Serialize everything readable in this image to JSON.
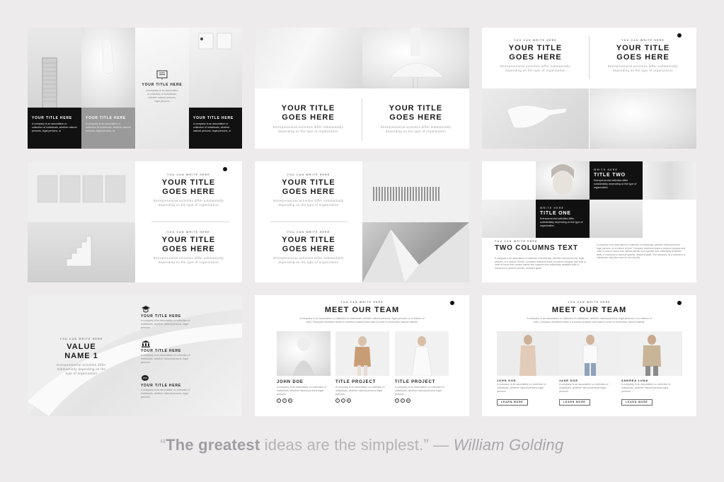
{
  "slides": {
    "s1": {
      "center_title": "YOUR TITLE HERE",
      "center_body": "A company is an association or collection of individuals, whether natural persons, legal persons",
      "box1_title": "YOUR TITLE HERE",
      "box1_body": "A company is an association or collection of individuals, whether natural persons, legal persons, or",
      "box2_title": "YOUR TITLE HERE",
      "box2_body": "A company is an association or collection of individuals, whether natural persons, legal persons, or",
      "box3_title": "YOUR TITLE HERE",
      "box3_body": "A company is an association or collection of individuals, whether natural persons, legal persons, or"
    },
    "s2": {
      "left_title": "YOUR TITLE\nGOES HERE",
      "left_sub": "Entrepreneurial activities differ substantially\ndepending on the type of organization",
      "right_title": "YOUR TITLE\nGOES HERE",
      "right_sub": "Entrepreneurial activities differ substantially\ndepending on the type of organization"
    },
    "s3": {
      "left_kicker": "YOU CAN WRITE HERE",
      "left_title": "YOUR TITLE\nGOES HERE",
      "left_sub": "Entrepreneurial activities differ substantially\ndepending on the type of organization",
      "right_kicker": "YOU CAN WRITE HERE",
      "right_title": "YOUR TITLE\nGOES HERE",
      "right_sub": "Entrepreneurial activities differ substantially\ndepending on the type of organization"
    },
    "s4": {
      "top_kicker": "YOU CAN WRITE HERE",
      "top_title": "YOUR TITLE\nGOES HERE",
      "top_sub": "Entrepreneurial activities differ substantially\ndepending on the type of organization",
      "bottom_kicker": "YOU CAN WRITE HERE",
      "bottom_title": "YOUR TITLE\nGOES HERE",
      "bottom_sub": "Entrepreneurial activities differ substantially\ndepending on the type of organization"
    },
    "s5": {
      "top_kicker": "YOU CAN WRITE HERE",
      "top_title": "YOUR TITLE\nGOES HERE",
      "top_sub": "Entrepreneurial activities differ substantially\ndepending on the type of organization",
      "bottom_kicker": "YOU CAN WRITE HERE",
      "bottom_title": "YOUR TITLE\nGOES HERE",
      "bottom_sub": "Entrepreneurial activities differ substantially\ndepending on the type of organization"
    },
    "s6": {
      "two_kicker": "WRITE HERE",
      "two_title": "TITLE TWO",
      "two_body": "Entrepreneurial activities differ substantially depending on the type of organization",
      "one_kicker": "WRITE HERE",
      "one_title": "TITLE ONE",
      "one_body": "Entrepreneurial activities differ substantially depending on the type of organization",
      "cols_kicker": "YOU CAN WRITE HERE",
      "cols_title": "TWO COLUMNS TEXT",
      "col1": "A company is an association or collection of individuals, whether natural persons, legal persons, or a mixture of both. Company members share a common purpose and unite in order to focus their various talents and organize their collectively available skills or resources to achieve specific, declared goals.",
      "col2": "A company is an association or collection of individuals, whether natural persons, legal persons, or a mixture of both. Company members share a common purpose and unite in order to focus their various talents and organize their collectively available skills or resources to achieve specific, declared goals. The company, as a collection of individuals, may also have its own identity."
    },
    "s7": {
      "kicker": "YOU CAN WRITE HERE",
      "title": "VALUE\nNAME 1",
      "sub": "Entrepreneurial activities differ\nsubstantially depending on the\ntype of organization",
      "items": [
        {
          "icon": "graduation-cap-icon",
          "title": "YOUR TITLE HERE",
          "body": "A company is an association or collection of individuals, whether natural persons, legal persons."
        },
        {
          "icon": "bank-icon",
          "title": "YOUR TITLE HERE",
          "body": "A company is an association or collection of individuals, whether natural persons, legal persons."
        },
        {
          "icon": "chat-bubbles-icon",
          "title": "YOUR TITLE HERE",
          "body": "A company is an association or collection of individuals, whether natural persons, legal persons."
        }
      ]
    },
    "s8": {
      "kicker": "YOU CAN WRITE HERE",
      "title": "MEET OUR TEAM",
      "sub": "A company is an association or collection of individuals, whether natural persons, legal persons, or a mixture of both. Company members share a common purpose and unite in order to focus their various talents.",
      "members": [
        {
          "name": "JOHN DOE",
          "body": "A company is an association or collection of individuals, whether natural persons legal persons."
        },
        {
          "name": "TITLE PROJECT",
          "body": "A company is an association or collection of individuals, whether natural persons legal persons."
        },
        {
          "name": "TITLE PROJECT",
          "body": "A company is an association or collection of individuals, whether natural persons legal persons."
        }
      ],
      "social": [
        "f",
        "t",
        "in"
      ]
    },
    "s9": {
      "kicker": "YOU CAN WRITE HERE",
      "title": "MEET OUR TEAM",
      "sub": "A company is an association or collection of individuals, whether natural persons, legal persons, or a mixture of both. Company members share a common purpose and unite in order to focus their various talents.",
      "members": [
        {
          "name": "JOHN DOE",
          "body": "A company is an association or collection of individuals, whether natural persons legal persons.",
          "button": "LEARN MORE"
        },
        {
          "name": "JANE DOE",
          "body": "A company is an association or collection of individuals, whether natural persons legal persons.",
          "button": "LEARN MORE"
        },
        {
          "name": "ANDREA LUNA",
          "body": "A company is an association or collection of individuals, whether natural persons legal persons.",
          "button": "LEARN MORE"
        }
      ]
    }
  },
  "quote": {
    "open_mark": "“",
    "bold": "The greatest",
    "rest": " ideas are the simplest.”",
    "dash": " — ",
    "author": "William Golding"
  },
  "colors": {
    "background": "#eeebec",
    "black": "#111111",
    "grey_box": "#9a9a9a",
    "quote_text": "#b4b4b4"
  }
}
